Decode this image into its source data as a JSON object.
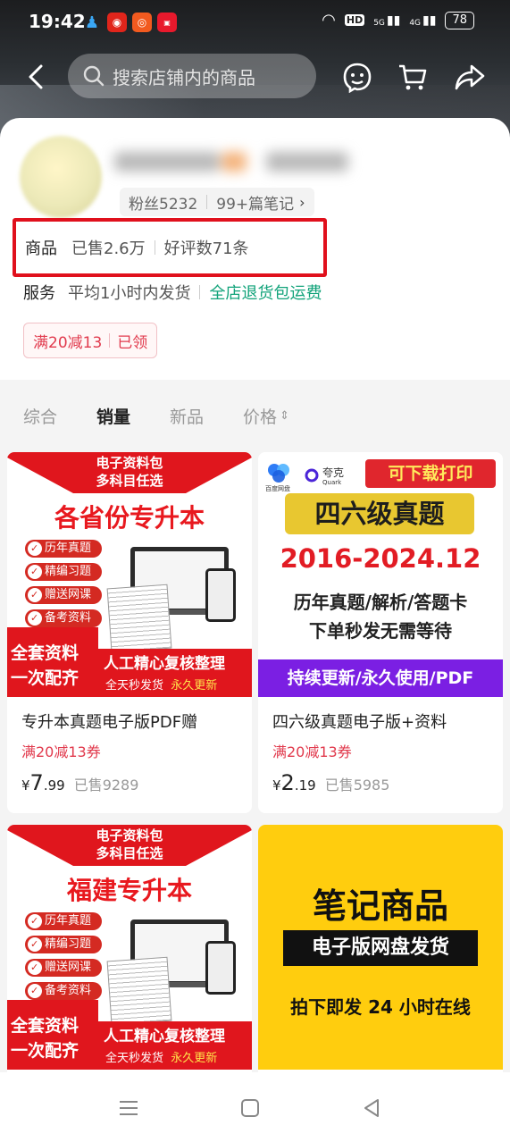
{
  "status_bar": {
    "time": "19:42",
    "battery": "78",
    "signal1": "5G",
    "signal2": "4G",
    "hd": "HD"
  },
  "search": {
    "placeholder": "搜索店铺内的商品"
  },
  "shop": {
    "fans": "粉丝5232",
    "notes": "99+篇笔记",
    "stats_label": "商品",
    "sold": "已售2.6万",
    "reviews": "好评数71条",
    "service_label": "服务",
    "service_ship": "平均1小时内发货",
    "service_return": "全店退货包运费",
    "coupon": "满20减13",
    "coupon_state": "已领"
  },
  "tabs": [
    "综合",
    "销量",
    "新品",
    "价格"
  ],
  "active_tab": "销量",
  "products": [
    {
      "title": "专升本真题电子版PDF赠",
      "coupon": "满20减13券",
      "price_cur": "¥",
      "price_int": "7",
      "price_dec": ".99",
      "sold": "已售9289",
      "img": {
        "top": "电子资料包",
        "top2": "多科目任选",
        "big": "各省份专升本",
        "chips": [
          "历年真题",
          "精编习题",
          "赠送网课",
          "备考资料"
        ],
        "red1": "全套资料",
        "red2": "一次配齐",
        "bottom1": "人工精心复核整理",
        "bottom2a": "全天秒发货",
        "bottom2b": "永久更新"
      }
    },
    {
      "title": "四六级真题电子版+资料",
      "coupon": "满20减13券",
      "price_cur": "¥",
      "price_int": "2",
      "price_dec": ".19",
      "sold": "已售5985",
      "img": {
        "logo1": "百度网盘",
        "logo2": "夸克",
        "logo2b": "Quark",
        "pill": "可下载打印",
        "yellow": "四六级真题",
        "years": "2016-2024.12",
        "line1": "历年真题/解析/答题卡",
        "line2": "下单秒发无需等待",
        "purple": "持续更新/永久使用/PDF"
      }
    },
    {
      "img": {
        "top": "电子资料包",
        "top2": "多科目任选",
        "big": "福建专升本",
        "chips": [
          "历年真题",
          "精编习题",
          "赠送网课",
          "备考资料"
        ],
        "red1": "全套资料",
        "red2": "一次配齐",
        "bottom1": "人工精心复核整理",
        "bottom2a": "全天秒发货",
        "bottom2b": "永久更新"
      }
    },
    {
      "img": {
        "t1": "笔记商品",
        "t2": "电子版网盘发货",
        "t3": "拍下即发 24 小时在线"
      }
    }
  ],
  "colors": {
    "accent_red": "#e0101c",
    "green": "#12a37a",
    "coupon_red": "#e13a4d"
  }
}
